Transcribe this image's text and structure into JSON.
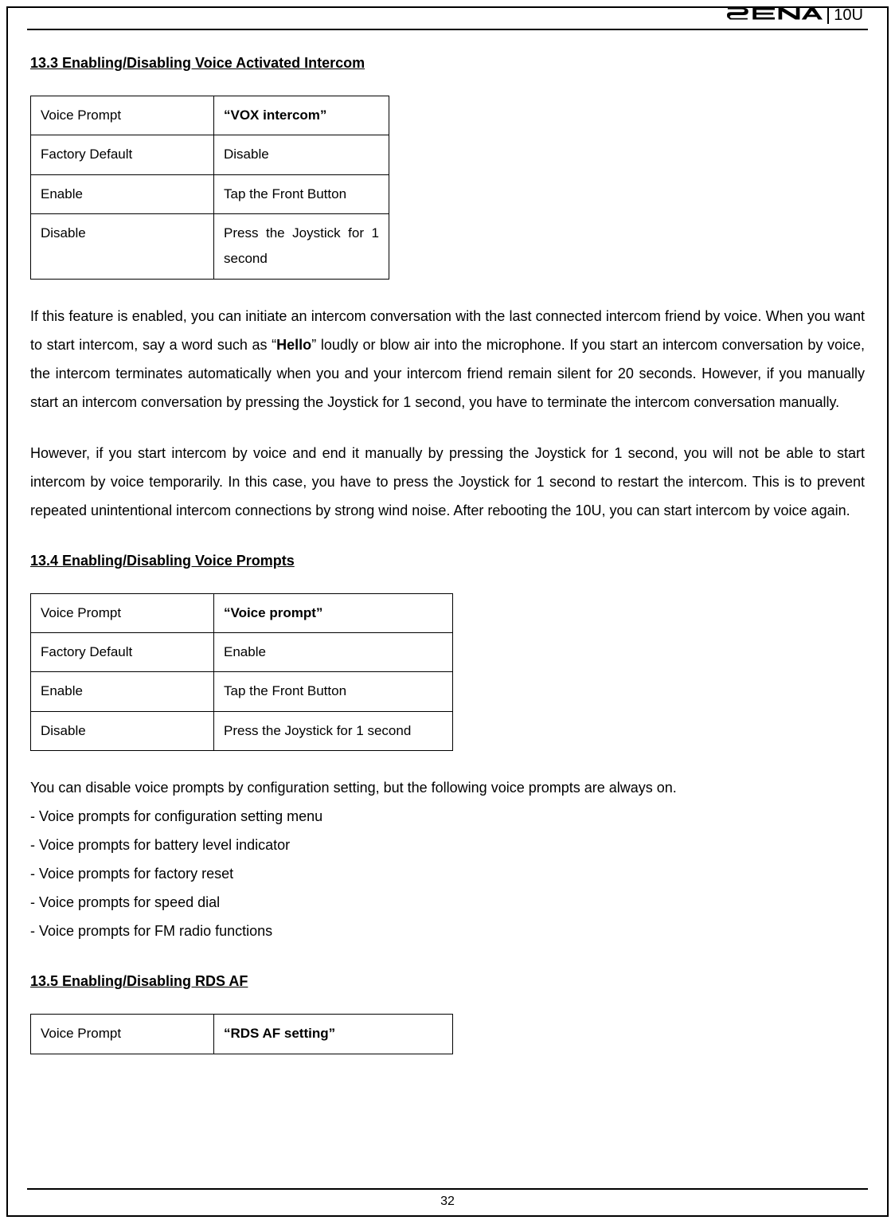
{
  "header": {
    "brand": "SENA",
    "model": "10U"
  },
  "section_133": {
    "heading": "13.3 Enabling/Disabling Voice Activated Intercom",
    "table": [
      {
        "label": "Voice Prompt",
        "value": "“VOX intercom”",
        "bold": true
      },
      {
        "label": "Factory Default",
        "value": "Disable"
      },
      {
        "label": "Enable",
        "value": "Tap the Front Button"
      },
      {
        "label": "Disable",
        "value": "Press the Joystick for 1 second"
      }
    ],
    "para1_pre": "If this feature is enabled, you can initiate an intercom conversation with the last connected intercom friend by voice. When you want to start intercom, say a word such as “",
    "para1_bold": "Hello",
    "para1_post": "” loudly or blow air into the microphone. If you start an intercom conversation by voice, the intercom terminates automatically when you and your intercom friend remain silent for 20 seconds. However, if you manually start an intercom conversation by pressing the Joystick for 1 second, you have to terminate the intercom conversation manually.",
    "para2": "However, if you start intercom by voice and end it manually by pressing the Joystick for 1 second, you will not be able to start intercom by voice temporarily. In this case, you have to press the Joystick for 1 second to restart the intercom. This is to prevent repeated unintentional intercom connections by strong wind noise. After rebooting the 10U, you can start intercom by voice again."
  },
  "section_134": {
    "heading": "13.4 Enabling/Disabling Voice Prompts",
    "table": [
      {
        "label": "Voice Prompt",
        "value": "“Voice prompt”",
        "bold": true
      },
      {
        "label": "Factory Default",
        "value": "Enable"
      },
      {
        "label": "Enable",
        "value": "Tap the Front Button"
      },
      {
        "label": "Disable",
        "value": "Press the Joystick for 1 second"
      }
    ],
    "intro": "You can disable voice prompts by configuration setting, but the following voice prompts are always on.",
    "items": [
      "- Voice prompts for configuration setting menu",
      "- Voice prompts for battery level indicator",
      "- Voice prompts for factory reset",
      "- Voice prompts for speed dial",
      "- Voice prompts for FM radio functions"
    ]
  },
  "section_135": {
    "heading": "13.5 Enabling/Disabling RDS AF",
    "table": [
      {
        "label": "Voice Prompt",
        "value": "“RDS AF setting”",
        "bold": true
      }
    ]
  },
  "footer": {
    "page_number": "32"
  }
}
